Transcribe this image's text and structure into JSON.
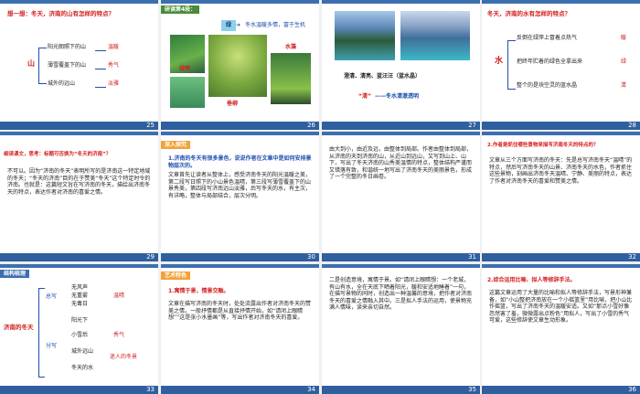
{
  "slides": [
    {
      "number": "25",
      "question": "想一想：冬天，济南的山有怎样的特点？",
      "center": "山",
      "items": [
        {
          "label": "阳光朗照下的山",
          "trait": "温暖"
        },
        {
          "label": "薄雪覆盖下的山",
          "trait": "秀气"
        },
        {
          "label": "城外的远山",
          "trait": "淡雅"
        }
      ]
    },
    {
      "number": "26",
      "heading": "研读第4段：",
      "arrow_label": "绿",
      "summary": "冬水温暖多情，富于生机",
      "photo_labels": {
        "water": "水藻",
        "grass": "绿萍",
        "willow": "垂柳"
      }
    },
    {
      "number": "27",
      "caption": "澄清、清亮、蓝汪汪（蓝水晶）",
      "quote": "“清”",
      "quote_note": "——冬水清澈透明"
    },
    {
      "number": "28",
      "question": "冬天，济南的水有怎样的特点？",
      "center": "水",
      "items": [
        {
          "label": "反倒在绿萍上冒着点热气",
          "trait": "暖"
        },
        {
          "label": "把终年贮着的绿色全拿出来",
          "trait": "绿"
        },
        {
          "label": "整个的是块空灵的蓝水晶",
          "trait": "清"
        }
      ]
    },
    {
      "number": "29",
      "heading": "细读课文，思考：标题可否换为“冬天的济南”？",
      "body": "不可以。因为“济南的冬天”表明所写的是济南这一特定地域的冬天；“冬天的济南”目的在于赞美“冬天”这个特定时令的济南。也就是：这篇短文旨在写济南的冬天，描绘出济南冬天的特点，表达作者对济南的喜爱之情。"
    },
    {
      "number": "30",
      "tag": "深入探究",
      "subheading": "1.济南的冬天有很多景色，说说作者在文章中是如何安排景物层次的。",
      "body": "文章首先让读者从整体上，感受济南冬天的阳光温暖之美，第二段写日照下的小山景色温晴，第三段写薄雪覆盖下的山景秀美，第四段写济南远山淡雅，后写冬天的水，有主次，有详略，整体与局部结合，层次分明。"
    },
    {
      "number": "31",
      "body": "由大到小，由近及远，由整体到局部。作者由整体到局部，从济南的天到济南的山，从近山到远山，又写到山上、山下，写出了冬天济南的山秀美温情的特点，整体结构严谨而又错落有致，和谐统一地写出了济南冬天的美丽景色，形成了一个完整的冬日画卷。"
    },
    {
      "number": "32",
      "subheading": "2.作者是抓住哪些景物来描写济南冬天的特点的？",
      "body": "文章从三个方面写济南的冬天：先是总写济南冬天“温晴”的特点，然后写济南冬天的山景、济南冬天的水色，作者抓住这些景物，刻画出济南冬天温晴、宁静、美丽的特点，表达了作者对济南冬天的喜爱和赞美之情。"
    },
    {
      "number": "33",
      "tag": "结构梳理",
      "root": "济南的冬天",
      "branches": [
        {
          "label": "总写",
          "items": [
            "无风声",
            "无重雾",
            "无毒日"
          ]
        },
        {
          "label": "分写",
          "items": [
            "阳光下",
            "小雪后",
            "城外远山",
            "冬天的水"
          ]
        }
      ],
      "side_labels": [
        "温晴",
        "秀气",
        "迷人的冬景"
      ]
    },
    {
      "number": "34",
      "tag": "艺术特色",
      "subheading": "1.寓情于景，情景交融。",
      "body": "文章在描写济南的冬天时，处处流露出作者对济南冬天的赞美之情。一般抒情都是从直接抒情开始，如“请闭上眼睛想”“这是张小水墨画”等，写出作者对济南冬天的喜爱。"
    },
    {
      "number": "35",
      "body": "二是创造意境，寓情于景。如“请闭上眼睛想：一个老城，有山有水，全在天底下晒着阳光，暖和安适地睡着”一句，在描写景物的同时，创造出一种温馨的意境，把作者对济南冬天的喜爱之情融入其中。三是拟人手法的运用，使景物充满人情味，读来亲切自然。"
    },
    {
      "number": "36",
      "subheading": "2.综合运用比喻、拟人等修辞手法。",
      "body": "这篇文章运用了大量的比喻和拟人等修辞手法，写景形神兼备，如“小山整把济南放在一个小摇篮里”用比喻，把小山比作摇篮，写出了济南冬天的温暖安适。又如“那点小雪好像忽然害了羞，微微露出点粉色”用拟人，写出了小雪的秀气可爱，这些修辞使文章生动形象。"
    }
  ]
}
